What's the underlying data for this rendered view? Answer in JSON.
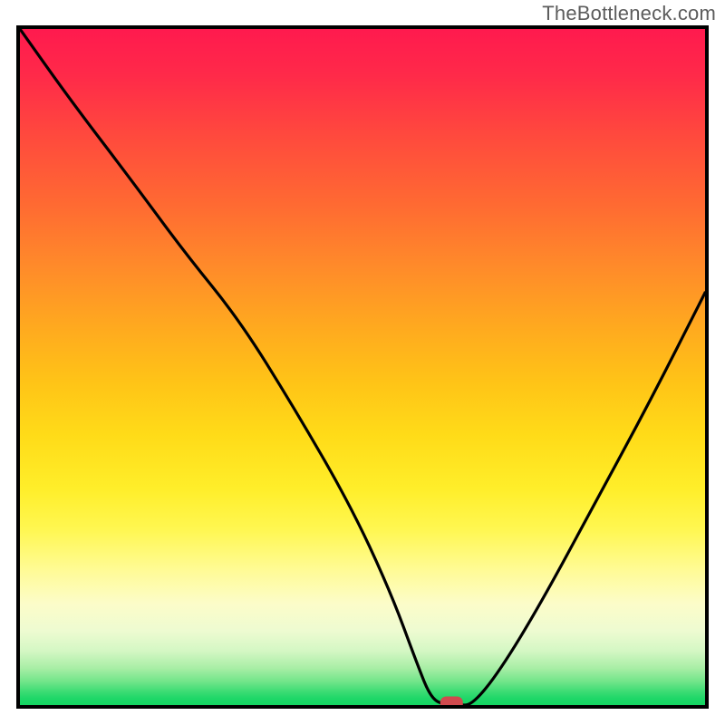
{
  "watermark": "TheBottleneck.com",
  "colors": {
    "frame_border": "#000000",
    "curve_stroke": "#000000",
    "marker_fill": "#d04a4e",
    "gradient_top": "#ff1a4e",
    "gradient_mid": "#ffee2a",
    "gradient_bottom": "#14d562"
  },
  "chart_data": {
    "type": "line",
    "title": "",
    "xlabel": "",
    "ylabel": "",
    "xlim": [
      0,
      100
    ],
    "ylim": [
      0,
      100
    ],
    "grid": false,
    "legend": false,
    "background": "heatmap-gradient red→yellow→green top→bottom",
    "series": [
      {
        "name": "bottleneck-curve",
        "x": [
          0,
          7,
          16,
          24,
          32,
          40,
          48,
          54,
          58,
          60,
          62,
          64,
          66,
          70,
          76,
          84,
          92,
          100
        ],
        "y": [
          100,
          90,
          78,
          67,
          57,
          44,
          30,
          17,
          6,
          1,
          0,
          0,
          0,
          5,
          15,
          30,
          45,
          61
        ]
      }
    ],
    "annotations": [
      {
        "name": "optimal-marker",
        "x": 63,
        "y": 0,
        "shape": "rounded-rect",
        "color": "#d04a4e"
      }
    ]
  }
}
